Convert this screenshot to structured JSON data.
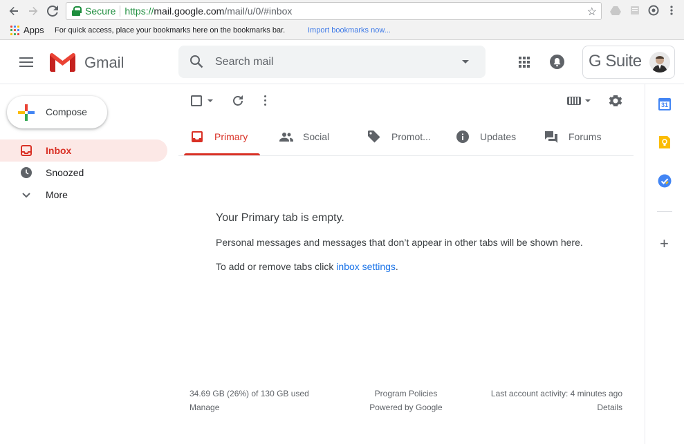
{
  "browser": {
    "secure_label": "Secure",
    "url_scheme": "https://",
    "url_host": "mail.google.com",
    "url_path": "/mail/u/0/#inbox",
    "bookmarks": {
      "apps_label": "Apps",
      "hint": "For quick access, place your bookmarks here on the bookmarks bar.",
      "import_link": "Import bookmarks now..."
    }
  },
  "header": {
    "product_name": "Gmail",
    "search_placeholder": "Search mail",
    "account_brand": "G Suite"
  },
  "sidebar": {
    "compose_label": "Compose",
    "items": [
      {
        "label": "Inbox",
        "icon": "inbox-icon",
        "active": true
      },
      {
        "label": "Snoozed",
        "icon": "clock-icon",
        "active": false
      },
      {
        "label": "More",
        "icon": "chevron-down-icon",
        "active": false
      }
    ]
  },
  "tabs": [
    {
      "label": "Primary",
      "icon": "inbox-icon"
    },
    {
      "label": "Social",
      "icon": "people-icon"
    },
    {
      "label": "Promot...",
      "icon": "tag-icon"
    },
    {
      "label": "Updates",
      "icon": "info-icon"
    },
    {
      "label": "Forums",
      "icon": "forum-icon"
    }
  ],
  "empty_state": {
    "title": "Your Primary tab is empty.",
    "message": "Personal messages and messages that don’t appear in other tabs will be shown here.",
    "tip_prefix": "To add or remove tabs click ",
    "tip_link": "inbox settings",
    "tip_suffix": "."
  },
  "footer": {
    "storage": "34.69 GB (26%) of 130 GB used",
    "manage": "Manage",
    "policies": "Program Policies",
    "powered": "Powered by Google",
    "activity": "Last account activity: 4 minutes ago",
    "details": "Details"
  },
  "side_panel": {
    "calendar_day": "31"
  },
  "colors": {
    "accent_red": "#d93025",
    "link_blue": "#1a73e8",
    "active_bg": "#fce8e6"
  }
}
